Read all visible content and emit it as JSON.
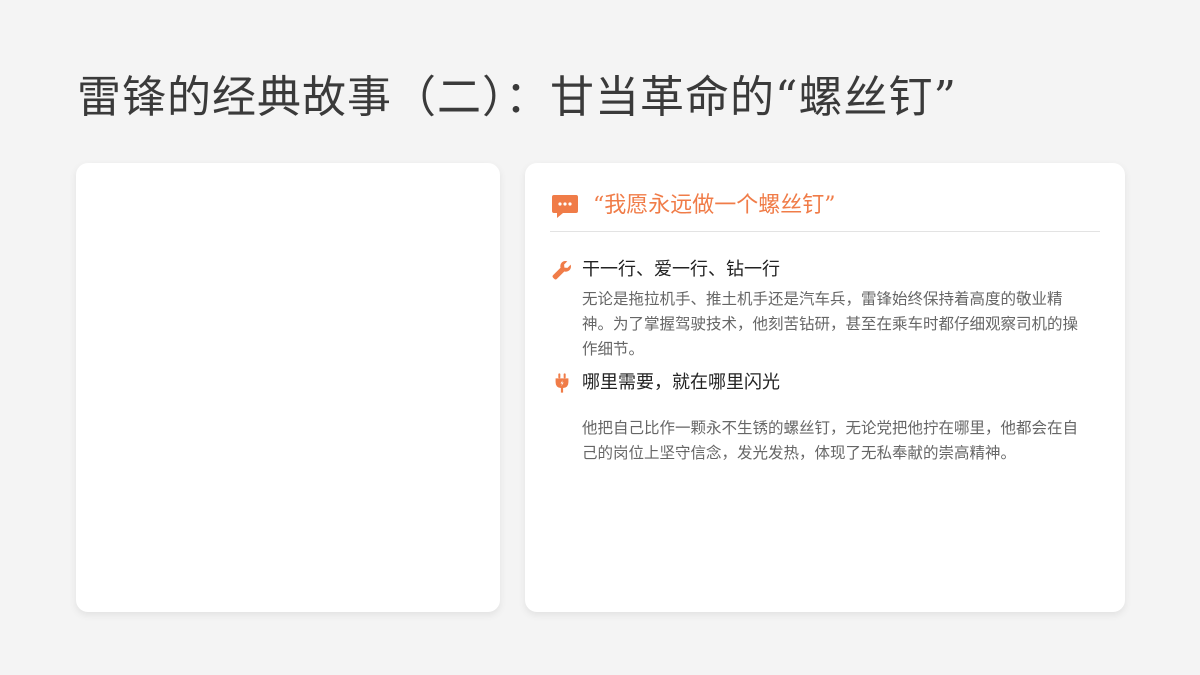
{
  "page": {
    "title": "雷锋的经典故事（二）：甘当革命的“螺丝钉”"
  },
  "colors": {
    "accent": "#f07c48",
    "background": "#f4f4f4",
    "card": "#ffffff",
    "body_text": "#666666"
  },
  "card_right": {
    "quote_icon": "chat-bubble-icon",
    "quote_title": "“我愿永远做一个螺丝钉”",
    "sections": [
      {
        "icon": "wrench-icon",
        "title": "干一行、爱一行、钻一行",
        "body": "无论是拖拉机手、推土机手还是汽车兵，雷锋始终保持着高度的敬业精神。为了掌握驾驶技术，他刻苦钻研，甚至在乘车时都仔细观察司机的操作细节。"
      },
      {
        "icon": "plug-icon",
        "title": "哪里需要，就在哪里闪光",
        "body": "他把自己比作一颗永不生锈的螺丝钉，无论党把他拧在哪里，他都会在自己的岗位上坚守信念，发光发热，体现了无私奉献的崇高精神。"
      }
    ]
  }
}
